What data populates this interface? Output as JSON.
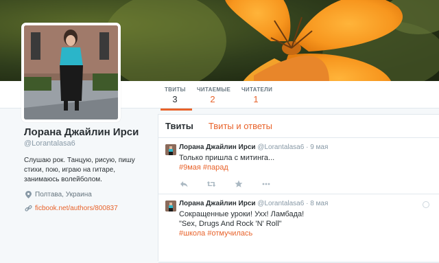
{
  "colors": {
    "accent": "#e8622a",
    "muted": "#8899a6",
    "text": "#292f33"
  },
  "nav": {
    "items": [
      {
        "label": "ТВИТЫ",
        "value": "3"
      },
      {
        "label": "ЧИТАЕМЫЕ",
        "value": "2"
      },
      {
        "label": "ЧИТАТЕЛИ",
        "value": "1"
      }
    ]
  },
  "profile": {
    "name": "Лорана Джайлин Ирси",
    "handle": "@Lorantalasa6",
    "bio": "Слушаю рок. Танцую, рисую, пишу стихи, пою, играю на гитаре, занимаюсь волейболом.",
    "location": "Полтава, Украина",
    "url": "ficbook.net/authors/800837",
    "location_icon": "map-pin-icon",
    "link_icon": "link-icon"
  },
  "timeline": {
    "tabs": [
      "Твиты",
      "Твиты и ответы"
    ],
    "tweets": [
      {
        "name": "Лорана Джайлин Ирси",
        "handle": "@Lorantalasa6",
        "dot": "·",
        "time": "9 мая",
        "lines": [
          "Только пришла с митинга..."
        ],
        "hashtags": "#9мая #парад"
      },
      {
        "name": "Лорана Джайлин Ирси",
        "handle": "@Lorantalasa6",
        "dot": "·",
        "time": "8 мая",
        "lines": [
          "Сокращенные уроки! Ухх! Ламбада!",
          "\"Sex, Drugs And Rock 'N' Roll\""
        ],
        "hashtags": "#школа #отмучилась"
      }
    ],
    "action_icons": [
      "reply-icon",
      "retweet-icon",
      "favorite-icon",
      "more-icon"
    ]
  }
}
